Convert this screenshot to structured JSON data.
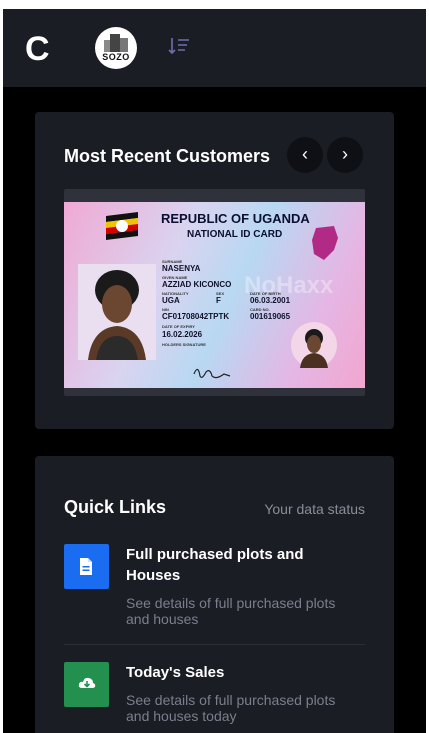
{
  "header": {
    "brand_letter": "C",
    "logo_text": "SOZO",
    "icons": [
      "sort-icon"
    ]
  },
  "recent_customers": {
    "title": "Most Recent Customers",
    "prev_label": "‹",
    "next_label": "›",
    "id_card": {
      "country": "REPUBLIC OF UGANDA",
      "doc_type": "NATIONAL ID CARD",
      "surname_label": "SURNAME",
      "surname": "NASENYA",
      "given_label": "GIVEN NAME",
      "given_name": "AZZIAD KICONCO",
      "nationality_label": "NATIONALITY",
      "nationality": "UGA",
      "sex_label": "SEX",
      "sex": "F",
      "dob_label": "DATE OF BIRTH",
      "dob": "06.03.2001",
      "nin_label": "NIN",
      "nin": "CF01708042TPTK",
      "card_no_label": "CARD NO.",
      "card_no": "001619065",
      "expiry_label": "DATE OF EXPIRY",
      "expiry": "16.02.2026",
      "signature_label": "HOLDERS SIGNATURE",
      "watermark": "NoHaxx"
    }
  },
  "quick_links": {
    "title": "Quick Links",
    "status": "Your data status",
    "items": [
      {
        "title": "Full purchased plots and Houses",
        "description": "See details of full purchased plots and houses",
        "icon": "document-icon",
        "color": "#1a6cf0"
      },
      {
        "title": "Today's Sales",
        "description": "See details of full purchased plots and houses today",
        "icon": "cloud-download-icon",
        "color": "#23904f"
      }
    ]
  },
  "colors": {
    "background": "#000000",
    "panel": "#1b1d25",
    "text": "#ffffff",
    "muted": "#7b7e8c"
  }
}
